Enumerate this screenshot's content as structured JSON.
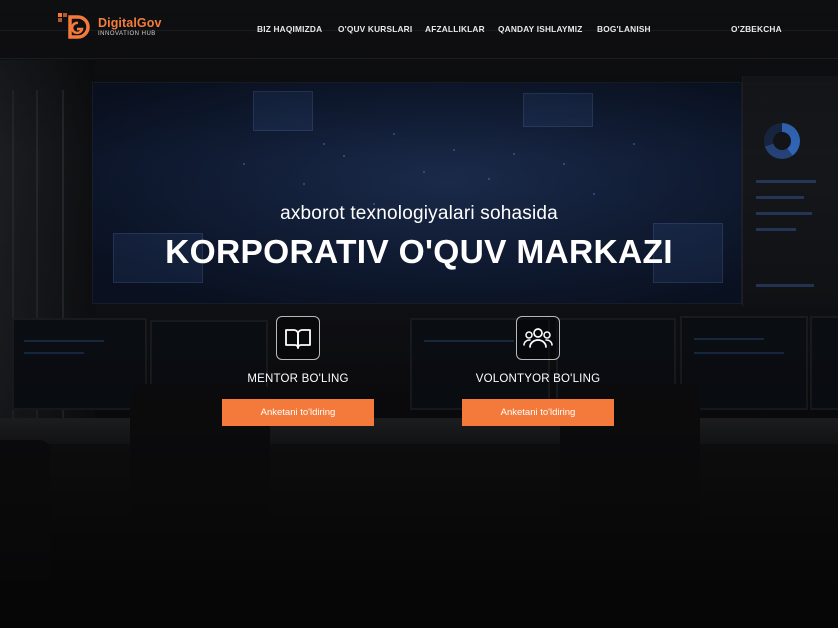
{
  "brand": {
    "name": "DigitalGov",
    "tagline": "INNOVATION HUB",
    "accent_color": "#f47a3b"
  },
  "nav": {
    "items": [
      {
        "label": "BIZ HAQIMIZDA"
      },
      {
        "label": "O'QUV KURSLARI"
      },
      {
        "label": "AFZALLIKLAR"
      },
      {
        "label": "QANDAY ISHLAYMIZ"
      },
      {
        "label": "BOG'LANISH"
      }
    ],
    "language": "O'ZBEKCHA"
  },
  "hero": {
    "subtitle": "axborot texnologiyalari sohasida",
    "title": "KORPORATIV O'QUV MARKAZI"
  },
  "cta": [
    {
      "icon": "book-icon",
      "label": "MENTOR BO'LING",
      "button": "Anketani to'ldiring"
    },
    {
      "icon": "users-icon",
      "label": "VOLONTYOR BO'LING",
      "button": "Anketani to'ldiring"
    }
  ]
}
